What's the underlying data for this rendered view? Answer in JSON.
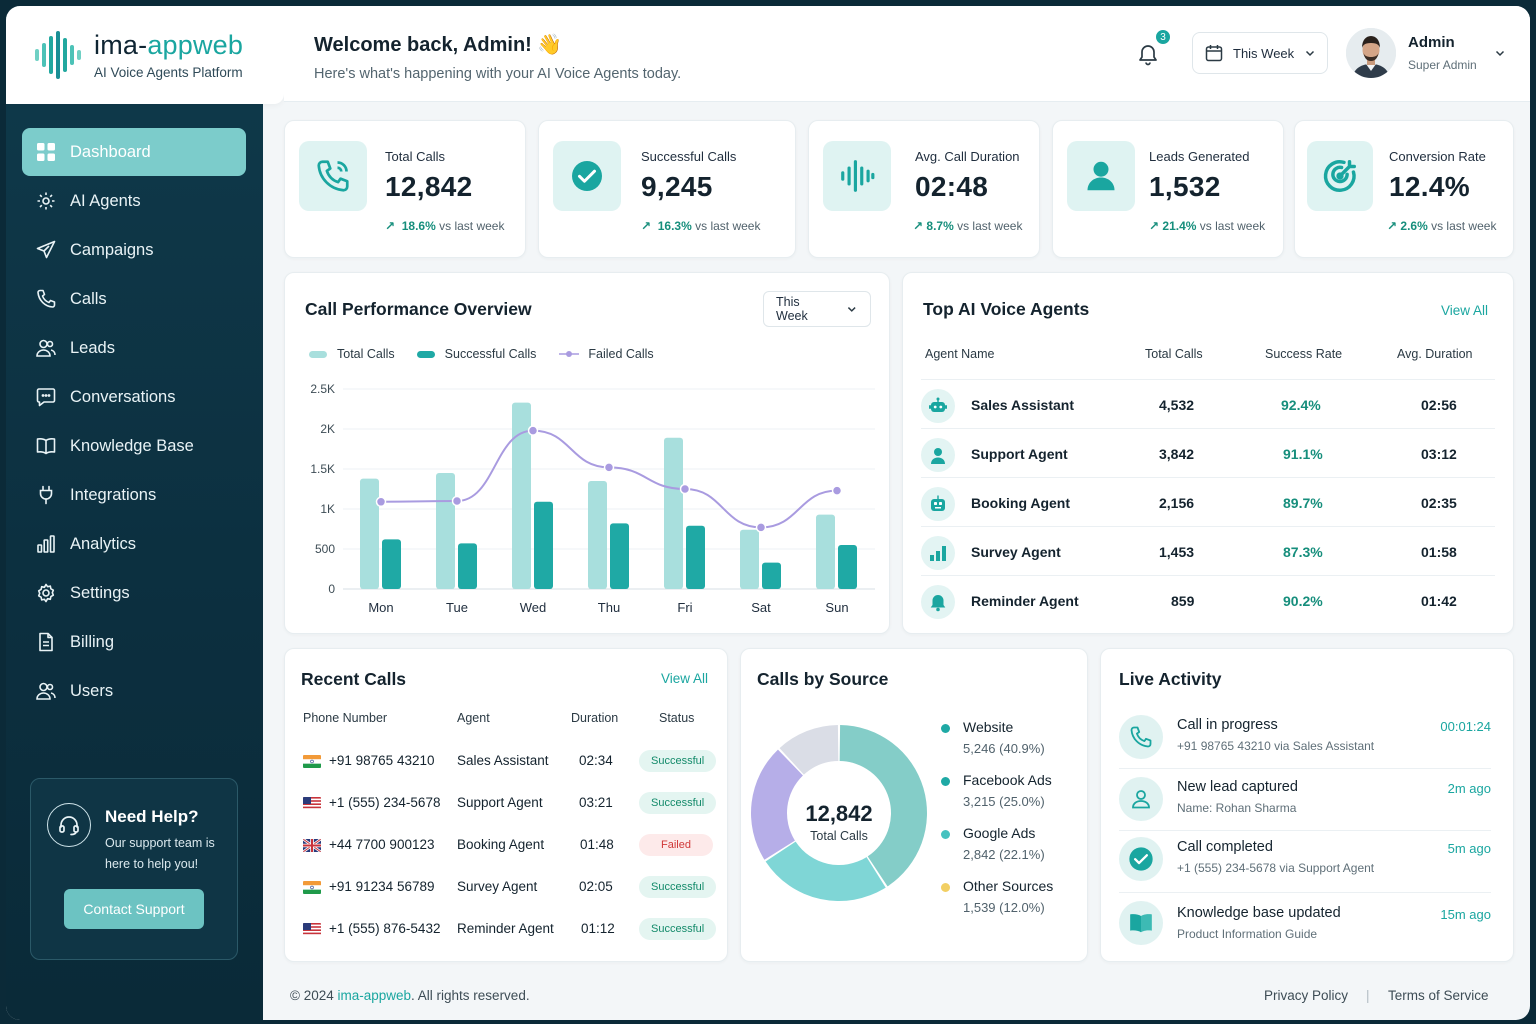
{
  "brand": {
    "name_prefix": "ima-",
    "name_suffix": "appweb",
    "subtitle": "AI Voice Agents Platform"
  },
  "sidebar": {
    "items": [
      {
        "label": "Dashboard",
        "icon": "grid-icon",
        "active": true
      },
      {
        "label": "AI Agents",
        "icon": "robot-gear-icon"
      },
      {
        "label": "Campaigns",
        "icon": "send-icon"
      },
      {
        "label": "Calls",
        "icon": "phone-icon"
      },
      {
        "label": "Leads",
        "icon": "users-icon"
      },
      {
        "label": "Conversations",
        "icon": "chat-icon"
      },
      {
        "label": "Knowledge Base",
        "icon": "book-icon"
      },
      {
        "label": "Integrations",
        "icon": "plug-icon"
      },
      {
        "label": "Analytics",
        "icon": "bar-chart-icon"
      },
      {
        "label": "Settings",
        "icon": "gear-icon"
      },
      {
        "label": "Billing",
        "icon": "document-icon"
      },
      {
        "label": "Users",
        "icon": "users-icon"
      }
    ],
    "help": {
      "title": "Need Help?",
      "text": "Our support team is here to help you!",
      "button": "Contact Support"
    }
  },
  "header": {
    "welcome": "Welcome back, Admin! 👋",
    "subtitle": "Here's what's happening with your AI Voice Agents today.",
    "notifications": "3",
    "period": "This Week",
    "user_name": "Admin",
    "user_role": "Super Admin"
  },
  "kpis": [
    {
      "label": "Total Calls",
      "value": "12,842",
      "change": "18.6%",
      "suffix": "vs last week",
      "icon": "phone-icon"
    },
    {
      "label": "Successful Calls",
      "value": "9,245",
      "change": "16.3%",
      "suffix": "vs last week",
      "icon": "check-circle-icon"
    },
    {
      "label": "Avg. Call Duration",
      "value": "02:48",
      "change": "8.7%",
      "suffix": "vs last week",
      "icon": "waveform-icon"
    },
    {
      "label": "Leads Generated",
      "value": "1,532",
      "change": "21.4%",
      "suffix": "vs last week",
      "icon": "user-icon"
    },
    {
      "label": "Conversion Rate",
      "value": "12.4%",
      "change": "2.6%",
      "suffix": "vs last week",
      "icon": "target-icon"
    }
  ],
  "performance": {
    "title": "Call Performance Overview",
    "period": "This Week",
    "legend": [
      "Total Calls",
      "Successful Calls",
      "Failed Calls"
    ]
  },
  "chart_data": {
    "type": "bar",
    "title": "Call Performance Overview",
    "categories": [
      "Mon",
      "Tue",
      "Wed",
      "Thu",
      "Fri",
      "Sat",
      "Sun"
    ],
    "series": [
      {
        "name": "Total Calls",
        "type": "bar",
        "values": [
          1380,
          1450,
          2330,
          1350,
          1890,
          740,
          930
        ]
      },
      {
        "name": "Successful Calls",
        "type": "bar",
        "values": [
          620,
          570,
          1090,
          820,
          790,
          330,
          550
        ]
      },
      {
        "name": "Failed Calls",
        "type": "line",
        "values": [
          1090,
          1100,
          1980,
          1520,
          1250,
          770,
          1230
        ]
      }
    ],
    "yticks": [
      "0",
      "500",
      "1K",
      "1.5K",
      "2K",
      "2.5K"
    ],
    "ylim": [
      0,
      2500
    ],
    "grid": true,
    "legend": "top-left",
    "colors": {
      "total": "#a8dfdd",
      "successful": "#1fa9a5",
      "failed": "#a99be0"
    }
  },
  "top_agents": {
    "title": "Top AI Voice Agents",
    "view_all": "View All",
    "columns": [
      "Agent Name",
      "Total Calls",
      "Success Rate",
      "Avg. Duration"
    ],
    "rows": [
      {
        "name": "Sales Assistant",
        "calls": "4,532",
        "rate": "92.4%",
        "duration": "02:56",
        "icon": "robot-icon"
      },
      {
        "name": "Support Agent",
        "calls": "3,842",
        "rate": "91.1%",
        "duration": "03:12",
        "icon": "headset-user-icon"
      },
      {
        "name": "Booking Agent",
        "calls": "2,156",
        "rate": "89.7%",
        "duration": "02:35",
        "icon": "robot-icon"
      },
      {
        "name": "Survey Agent",
        "calls": "1,453",
        "rate": "87.3%",
        "duration": "01:58",
        "icon": "bar-chart-icon"
      },
      {
        "name": "Reminder Agent",
        "calls": "859",
        "rate": "90.2%",
        "duration": "01:42",
        "icon": "bell-icon"
      }
    ]
  },
  "recent_calls": {
    "title": "Recent Calls",
    "view_all": "View All",
    "columns": [
      "Phone Number",
      "Agent",
      "Duration",
      "Status"
    ],
    "rows": [
      {
        "flag": "india-flag-icon",
        "phone": "+91 98765 43210",
        "agent": "Sales Assistant",
        "duration": "02:34",
        "status": "Successful"
      },
      {
        "flag": "us-flag-icon",
        "phone": "+1 (555) 234-5678",
        "agent": "Support Agent",
        "duration": "03:21",
        "status": "Successful"
      },
      {
        "flag": "uk-flag-icon",
        "phone": "+44 7700 900123",
        "agent": "Booking Agent",
        "duration": "01:48",
        "status": "Failed"
      },
      {
        "flag": "india-flag-icon",
        "phone": "+91 91234 56789",
        "agent": "Survey Agent",
        "duration": "02:05",
        "status": "Successful"
      },
      {
        "flag": "us-flag-icon",
        "phone": "+1 (555) 876-5432",
        "agent": "Reminder Agent",
        "duration": "01:12",
        "status": "Successful"
      }
    ]
  },
  "sources": {
    "title": "Calls by Source",
    "center_value": "12,842",
    "center_label": "Total Calls",
    "items": [
      {
        "name": "Website",
        "detail": "5,246 (40.9%)",
        "value": 40.9,
        "color": "#84cdc8"
      },
      {
        "name": "Facebook Ads",
        "detail": "3,215 (25.0%)",
        "value": 25.0,
        "color": "#7fd6d6"
      },
      {
        "name": "Google Ads",
        "detail": "2,842 (22.1%)",
        "value": 22.1,
        "color": "#b6aee8"
      },
      {
        "name": "Other Sources",
        "detail": "1,539 (12.0%)",
        "value": 12.0,
        "color": "#dadde6"
      }
    ],
    "legend_colors": [
      "#1fa9a5",
      "#1fa9a5",
      "#47c2c0",
      "#f2cf63"
    ]
  },
  "live_activity": {
    "title": "Live Activity",
    "items": [
      {
        "title": "Call in progress",
        "sub": "+91 98765 43210 via Sales Assistant",
        "time": "00:01:24",
        "icon": "phone-icon"
      },
      {
        "title": "New lead captured",
        "sub": "Name: Rohan Sharma",
        "time": "2m ago",
        "icon": "user-icon"
      },
      {
        "title": "Call completed",
        "sub": "+1 (555) 234-5678 via Support Agent",
        "time": "5m ago",
        "icon": "check-circle-icon"
      },
      {
        "title": "Knowledge base updated",
        "sub": "Product Information Guide",
        "time": "15m ago",
        "icon": "book-icon"
      }
    ]
  },
  "footer": {
    "copyright_prefix": "© 2024 ",
    "brand": "ima-appweb",
    "copyright_suffix": ". All rights reserved.",
    "privacy": "Privacy Policy",
    "separator": "|",
    "terms": "Terms of Service"
  }
}
